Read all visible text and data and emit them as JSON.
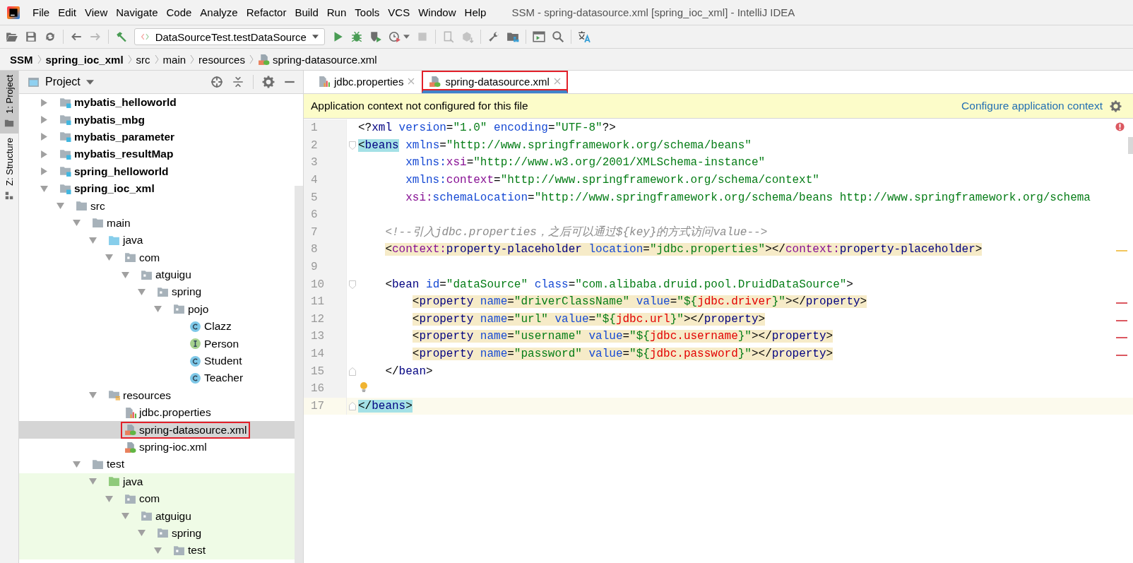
{
  "window": {
    "title": "SSM - spring-datasource.xml [spring_ioc_xml] - IntelliJ IDEA"
  },
  "menu": [
    "File",
    "Edit",
    "View",
    "Navigate",
    "Code",
    "Analyze",
    "Refactor",
    "Build",
    "Run",
    "Tools",
    "VCS",
    "Window",
    "Help"
  ],
  "toolbar": {
    "run_configuration": "DataSourceTest.testDataSource"
  },
  "breadcrumbs": [
    {
      "label": "SSM",
      "kind": "project"
    },
    {
      "label": "spring_ioc_xml",
      "kind": "module"
    },
    {
      "label": "src",
      "kind": "folder"
    },
    {
      "label": "main",
      "kind": "folder"
    },
    {
      "label": "resources",
      "kind": "folder"
    },
    {
      "label": "spring-datasource.xml",
      "kind": "xml"
    }
  ],
  "tool_stripe": [
    {
      "label": "1: Project",
      "selected": true
    },
    {
      "label": "Z: Structure",
      "selected": false
    }
  ],
  "project_panel": {
    "title": "Project",
    "tree": [
      {
        "name": "mybatis_helloworld",
        "kind": "module",
        "expanded": false,
        "selected": false
      },
      {
        "name": "mybatis_mbg",
        "kind": "module",
        "expanded": false,
        "selected": false
      },
      {
        "name": "mybatis_parameter",
        "kind": "module",
        "expanded": false,
        "selected": false
      },
      {
        "name": "mybatis_resultMap",
        "kind": "module",
        "expanded": false,
        "selected": false
      },
      {
        "name": "spring_helloworld",
        "kind": "module",
        "expanded": false,
        "selected": false
      },
      {
        "name": "spring_ioc_xml",
        "kind": "module",
        "expanded": true,
        "selected": false,
        "children": [
          {
            "name": "src",
            "kind": "folder",
            "expanded": true,
            "selected": false,
            "children": [
              {
                "name": "main",
                "kind": "folder",
                "expanded": true,
                "selected": false,
                "children": [
                  {
                    "name": "java",
                    "kind": "source",
                    "expanded": true,
                    "selected": false,
                    "children": [
                      {
                        "name": "com",
                        "kind": "package",
                        "expanded": true,
                        "selected": false,
                        "children": [
                          {
                            "name": "atguigu",
                            "kind": "package",
                            "expanded": true,
                            "selected": false,
                            "children": [
                              {
                                "name": "spring",
                                "kind": "package",
                                "expanded": true,
                                "selected": false,
                                "children": [
                                  {
                                    "name": "pojo",
                                    "kind": "package",
                                    "expanded": true,
                                    "selected": false,
                                    "children": [
                                      {
                                        "name": "Clazz",
                                        "kind": "class",
                                        "selected": false
                                      },
                                      {
                                        "name": "Person",
                                        "kind": "interface",
                                        "selected": false
                                      },
                                      {
                                        "name": "Student",
                                        "kind": "class",
                                        "selected": false
                                      },
                                      {
                                        "name": "Teacher",
                                        "kind": "class",
                                        "selected": false
                                      }
                                    ]
                                  }
                                ]
                              }
                            ]
                          }
                        ]
                      }
                    ]
                  },
                  {
                    "name": "resources",
                    "kind": "resources",
                    "expanded": true,
                    "selected": false,
                    "children": [
                      {
                        "name": "jdbc.properties",
                        "kind": "properties",
                        "selected": false
                      },
                      {
                        "name": "spring-datasource.xml",
                        "kind": "xml",
                        "selected": true,
                        "annotated": true
                      },
                      {
                        "name": "spring-ioc.xml",
                        "kind": "xml",
                        "selected": false
                      }
                    ]
                  }
                ]
              },
              {
                "name": "test",
                "kind": "folder",
                "expanded": true,
                "selected": false,
                "children": [
                  {
                    "name": "java",
                    "kind": "test-source",
                    "expanded": true,
                    "selected": false,
                    "children": [
                      {
                        "name": "com",
                        "kind": "package",
                        "expanded": true,
                        "selected": false,
                        "children": [
                          {
                            "name": "atguigu",
                            "kind": "package",
                            "expanded": true,
                            "selected": false,
                            "children": [
                              {
                                "name": "spring",
                                "kind": "package",
                                "expanded": true,
                                "selected": false,
                                "children": [
                                  {
                                    "name": "test",
                                    "kind": "package",
                                    "expanded": true,
                                    "selected": false
                                  }
                                ]
                              }
                            ]
                          }
                        ]
                      }
                    ]
                  }
                ]
              }
            ]
          }
        ]
      }
    ]
  },
  "editor": {
    "tabs": [
      {
        "label": "jdbc.properties",
        "kind": "properties",
        "selected": false,
        "annotated": false
      },
      {
        "label": "spring-datasource.xml",
        "kind": "xml",
        "selected": true,
        "annotated": true
      }
    ],
    "notice": {
      "text": "Application context not configured for this file",
      "link": "Configure application context"
    },
    "inspection": {
      "kind": "error"
    },
    "lines": [
      {
        "number": "1",
        "kind": "top",
        "highlight": false,
        "tokens": [
          {
            "kind": "p",
            "text": "<?"
          },
          {
            "kind": "tag",
            "text": "xml"
          },
          {
            "kind": "attr",
            "text": " version"
          },
          {
            "kind": "p",
            "text": "="
          },
          {
            "kind": "str",
            "text": "\"1.0\""
          },
          {
            "kind": "attr",
            "text": " encoding"
          },
          {
            "kind": "p",
            "text": "="
          },
          {
            "kind": "str",
            "text": "\"UTF-8\""
          },
          {
            "kind": "p",
            "text": "?>"
          }
        ]
      },
      {
        "number": "2",
        "kind": "top",
        "highlight": false,
        "fold": {
          "kind": "start"
        },
        "tokens": [
          {
            "kind": "p-match",
            "text": "<"
          },
          {
            "kind": "tag-match",
            "text": "beans"
          },
          {
            "kind": "attr",
            "text": " xmlns"
          },
          {
            "kind": "p",
            "text": "="
          },
          {
            "kind": "str",
            "text": "\"http://www.springframework.org/schema/beans\""
          }
        ]
      },
      {
        "number": "3",
        "kind": "attr",
        "highlight": false,
        "tokens": [
          {
            "kind": "attr",
            "text": "xmlns:"
          },
          {
            "kind": "ns",
            "text": "xsi"
          },
          {
            "kind": "p",
            "text": "="
          },
          {
            "kind": "str",
            "text": "\"http://www.w3.org/2001/XMLSchema-instance\""
          }
        ]
      },
      {
        "number": "4",
        "kind": "attr",
        "highlight": false,
        "tokens": [
          {
            "kind": "attr",
            "text": "xmlns:"
          },
          {
            "kind": "ns",
            "text": "context"
          },
          {
            "kind": "p",
            "text": "="
          },
          {
            "kind": "str",
            "text": "\"http://www.springframework.org/schema/context\""
          }
        ]
      },
      {
        "number": "5",
        "kind": "attr",
        "highlight": false,
        "tokens": [
          {
            "kind": "ns",
            "text": "xsi:"
          },
          {
            "kind": "attr",
            "text": "schemaLocation"
          },
          {
            "kind": "p",
            "text": "="
          },
          {
            "kind": "str",
            "text": "\"http://www.springframework.org/schema/beans http://www.springframework.org/schema"
          }
        ]
      },
      {
        "number": "6",
        "highlight": false
      },
      {
        "number": "7",
        "kind": "inner",
        "highlight": false,
        "tokens": [
          {
            "kind": "cmt",
            "text": "<!--引入jdbc.properties，之后可以通过${key}的方式访问value-->"
          }
        ]
      },
      {
        "number": "8",
        "kind": "inner",
        "highlight": true,
        "marker": {
          "kind": "warning"
        },
        "tokens": [
          {
            "kind": "p",
            "text": "<"
          },
          {
            "kind": "ns",
            "text": "context:"
          },
          {
            "kind": "tag",
            "text": "property-placeholder"
          },
          {
            "kind": "attr",
            "text": " location"
          },
          {
            "kind": "p",
            "text": "="
          },
          {
            "kind": "str",
            "text": "\"jdbc.properties\""
          },
          {
            "kind": "p",
            "text": "></"
          },
          {
            "kind": "ns",
            "text": "context:"
          },
          {
            "kind": "tag",
            "text": "property-placeholder"
          },
          {
            "kind": "p",
            "text": ">"
          }
        ]
      },
      {
        "number": "9",
        "highlight": false
      },
      {
        "number": "10",
        "kind": "inner",
        "highlight": false,
        "fold": {
          "kind": "start"
        },
        "tokens": [
          {
            "kind": "p",
            "text": "<"
          },
          {
            "kind": "tag",
            "text": "bean"
          },
          {
            "kind": "attr",
            "text": " id"
          },
          {
            "kind": "p",
            "text": "="
          },
          {
            "kind": "str",
            "text": "\"dataSource\""
          },
          {
            "kind": "attr",
            "text": " class"
          },
          {
            "kind": "p",
            "text": "="
          },
          {
            "kind": "str",
            "text": "\"com.alibaba.druid.pool.DruidDataSource\""
          },
          {
            "kind": "p",
            "text": ">"
          }
        ]
      },
      {
        "number": "11",
        "kind": "deep",
        "highlight": true,
        "marker": {
          "kind": "error"
        },
        "tokens": [
          {
            "kind": "p",
            "text": "<"
          },
          {
            "kind": "tag",
            "text": "property"
          },
          {
            "kind": "attr",
            "text": " name"
          },
          {
            "kind": "p",
            "text": "="
          },
          {
            "kind": "str",
            "text": "\"driverClassName\""
          },
          {
            "kind": "attr",
            "text": " value"
          },
          {
            "kind": "p",
            "text": "="
          },
          {
            "kind": "str",
            "text": "\"${"
          },
          {
            "kind": "var",
            "text": "jdbc.driver"
          },
          {
            "kind": "str",
            "text": "}\""
          },
          {
            "kind": "p",
            "text": "></"
          },
          {
            "kind": "tag",
            "text": "property"
          },
          {
            "kind": "p",
            "text": ">"
          }
        ]
      },
      {
        "number": "12",
        "kind": "deep",
        "highlight": true,
        "marker": {
          "kind": "error"
        },
        "tokens": [
          {
            "kind": "p",
            "text": "<"
          },
          {
            "kind": "tag",
            "text": "property"
          },
          {
            "kind": "attr",
            "text": " name"
          },
          {
            "kind": "p",
            "text": "="
          },
          {
            "kind": "str",
            "text": "\"url\""
          },
          {
            "kind": "attr",
            "text": " value"
          },
          {
            "kind": "p",
            "text": "="
          },
          {
            "kind": "str",
            "text": "\"${"
          },
          {
            "kind": "var",
            "text": "jdbc.url"
          },
          {
            "kind": "str",
            "text": "}\""
          },
          {
            "kind": "p",
            "text": "></"
          },
          {
            "kind": "tag",
            "text": "property"
          },
          {
            "kind": "p",
            "text": ">"
          }
        ]
      },
      {
        "number": "13",
        "kind": "deep",
        "highlight": true,
        "marker": {
          "kind": "error"
        },
        "tokens": [
          {
            "kind": "p",
            "text": "<"
          },
          {
            "kind": "tag",
            "text": "property"
          },
          {
            "kind": "attr",
            "text": " name"
          },
          {
            "kind": "p",
            "text": "="
          },
          {
            "kind": "str",
            "text": "\"username\""
          },
          {
            "kind": "attr",
            "text": " value"
          },
          {
            "kind": "p",
            "text": "="
          },
          {
            "kind": "str",
            "text": "\"${"
          },
          {
            "kind": "var",
            "text": "jdbc.username"
          },
          {
            "kind": "str",
            "text": "}\""
          },
          {
            "kind": "p",
            "text": "></"
          },
          {
            "kind": "tag",
            "text": "property"
          },
          {
            "kind": "p",
            "text": ">"
          }
        ]
      },
      {
        "number": "14",
        "kind": "deep",
        "highlight": true,
        "marker": {
          "kind": "error"
        },
        "tokens": [
          {
            "kind": "p",
            "text": "<"
          },
          {
            "kind": "tag",
            "text": "property"
          },
          {
            "kind": "attr",
            "text": " name"
          },
          {
            "kind": "p",
            "text": "="
          },
          {
            "kind": "str",
            "text": "\"password\""
          },
          {
            "kind": "attr",
            "text": " value"
          },
          {
            "kind": "p",
            "text": "="
          },
          {
            "kind": "str",
            "text": "\"${"
          },
          {
            "kind": "var",
            "text": "jdbc.password"
          },
          {
            "kind": "str",
            "text": "}\""
          },
          {
            "kind": "p",
            "text": "></"
          },
          {
            "kind": "tag",
            "text": "property"
          },
          {
            "kind": "p",
            "text": ">"
          }
        ]
      },
      {
        "number": "15",
        "kind": "inner",
        "highlight": false,
        "fold": {
          "kind": "end"
        },
        "tokens": [
          {
            "kind": "p",
            "text": "</"
          },
          {
            "kind": "tag",
            "text": "bean"
          },
          {
            "kind": "p",
            "text": ">"
          }
        ]
      },
      {
        "number": "16",
        "highlight": false,
        "marker": {
          "kind": "bulb"
        }
      },
      {
        "number": "17",
        "kind": "top",
        "highlight": false,
        "current": true,
        "fold": {
          "kind": "end"
        },
        "tokens": [
          {
            "kind": "p-match",
            "text": "</"
          },
          {
            "kind": "tag-match",
            "text": "beans"
          },
          {
            "kind": "p-match",
            "text": ">"
          }
        ]
      }
    ]
  }
}
